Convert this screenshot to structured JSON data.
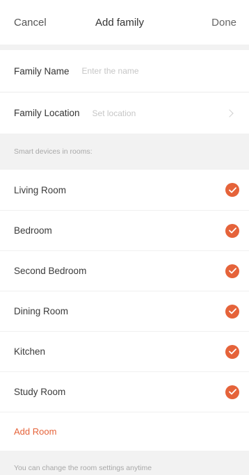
{
  "navbar": {
    "cancel_label": "Cancel",
    "title": "Add family",
    "done_label": "Done"
  },
  "form": {
    "family_name_label": "Family Name",
    "family_name_placeholder": "Enter the name",
    "family_name_value": "",
    "family_location_label": "Family Location",
    "family_location_value": "Set location"
  },
  "rooms_section": {
    "header": "Smart devices in rooms:",
    "rooms": [
      {
        "label": "Living Room",
        "checked": true
      },
      {
        "label": "Bedroom",
        "checked": true
      },
      {
        "label": "Second Bedroom",
        "checked": true
      },
      {
        "label": "Dining Room",
        "checked": true
      },
      {
        "label": "Kitchen",
        "checked": true
      },
      {
        "label": "Study Room",
        "checked": true
      }
    ],
    "add_room_label": "Add Room",
    "footer_note": "You can change the room settings anytime"
  },
  "colors": {
    "accent": "#e5633a",
    "background": "#f2f2f2"
  },
  "icons": {
    "check": "check-circle-icon",
    "chevron": "chevron-right-icon"
  }
}
